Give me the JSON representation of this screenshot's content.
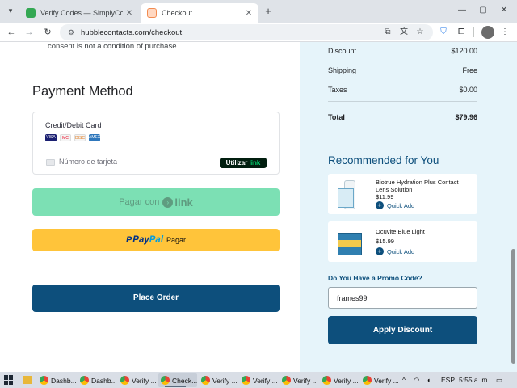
{
  "browser": {
    "tabs": [
      {
        "title": "Verify Codes — SimplyCodes",
        "close": "✕"
      },
      {
        "title": "Checkout",
        "close": "✕"
      }
    ],
    "new_tab": "+",
    "url": "hubblecontacts.com/checkout"
  },
  "page": {
    "consent_text": "consent is not a condition of purchase.",
    "payment_title": "Payment Method",
    "card": {
      "label": "Credit/Debit Card",
      "logos": [
        "VISA",
        "MC",
        "DISC",
        "AMEX"
      ],
      "number_placeholder": "Número de tarjeta",
      "link_badge_prefix": "Utilizar",
      "link_badge_word": "link"
    },
    "pay_with_link": {
      "prefix": "Pagar con",
      "icon": "›",
      "word": "link"
    },
    "paypal": {
      "p": "P",
      "pay": "Pay",
      "pal": "Pal",
      "text": "Pagar"
    },
    "place_order": "Place Order"
  },
  "summary": {
    "rows": [
      {
        "label": "Discount",
        "value": "$120.00"
      },
      {
        "label": "Shipping",
        "value": "Free"
      },
      {
        "label": "Taxes",
        "value": "$0.00"
      }
    ],
    "total": {
      "label": "Total",
      "value": "$79.96"
    }
  },
  "recommended": {
    "title": "Recommended for You",
    "quick_add_icon": "+",
    "items": [
      {
        "name": "Biotrue Hydration Plus Contact Lens Solution",
        "price": "$11.99",
        "action": "Quick Add"
      },
      {
        "name": "Ocuvite Blue Light",
        "price": "$15.99",
        "action": "Quick Add"
      }
    ]
  },
  "promo": {
    "label": "Do You Have a Promo Code?",
    "value": "frames99",
    "apply": "Apply Discount"
  },
  "taskbar": {
    "items": [
      {
        "label": "Dashb...",
        "icon": "chrome"
      },
      {
        "label": "Dashb...",
        "icon": "chrome"
      },
      {
        "label": "Verify ...",
        "icon": "chrome"
      },
      {
        "label": "Check...",
        "icon": "chrome",
        "active": true
      },
      {
        "label": "Verify ...",
        "icon": "chrome"
      },
      {
        "label": "Verify ...",
        "icon": "chrome"
      },
      {
        "label": "Verify ...",
        "icon": "chrome"
      },
      {
        "label": "Verify ...",
        "icon": "chrome"
      },
      {
        "label": "Verify ...",
        "icon": "chrome"
      }
    ],
    "tray_caret": "^",
    "tray_wifi": "◠",
    "tray_volume": "◖",
    "lang": "ESP",
    "time": "5:55 a. m.",
    "notif": "▭"
  },
  "colors": {
    "primary": "#0d4f7c",
    "link_green": "#7ce0b4",
    "paypal_yellow": "#ffc43a",
    "summary_bg": "#e6f4fa"
  }
}
